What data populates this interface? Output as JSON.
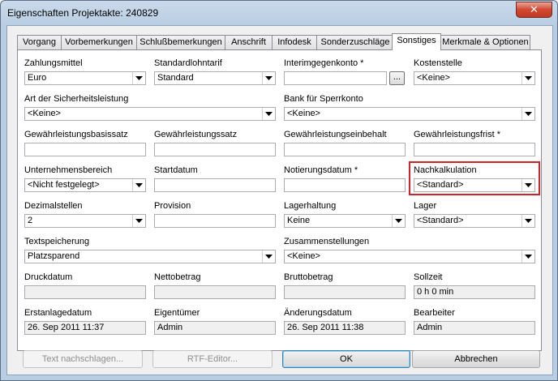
{
  "window": {
    "title": "Eigenschaften Projektakte: 240829",
    "close_glyph": "✕"
  },
  "tabs": [
    {
      "label": "Vorgang",
      "active": false
    },
    {
      "label": "Vorbemerkungen",
      "active": false
    },
    {
      "label": "Schlußbemerkungen",
      "active": false
    },
    {
      "label": "Anschrift",
      "active": false
    },
    {
      "label": "Infodesk",
      "active": false
    },
    {
      "label": "Sonderzuschläge",
      "active": false
    },
    {
      "label": "Sonstiges",
      "active": true
    },
    {
      "label": "Merkmale & Optionen",
      "active": false
    }
  ],
  "form": {
    "zahlungsmittel": {
      "label": "Zahlungsmittel",
      "value": "Euro"
    },
    "standardlohntarif": {
      "label": "Standardlohntarif",
      "value": "Standard"
    },
    "interimgegenkonto": {
      "label": "Interimgegenkonto *",
      "value": "",
      "button": "..."
    },
    "kostenstelle": {
      "label": "Kostenstelle",
      "value": "<Keine>"
    },
    "art_sicherheitsleistung": {
      "label": "Art der Sicherheitsleistung",
      "value": "<Keine>"
    },
    "bank_sperrkonto": {
      "label": "Bank für Sperrkonto",
      "value": "<Keine>"
    },
    "gewaehrleistungsbasissatz": {
      "label": "Gewährleistungsbasissatz",
      "value": ""
    },
    "gewaehrleistungssatz": {
      "label": "Gewährleistungssatz",
      "value": ""
    },
    "gewaehrleistungseinbehalt": {
      "label": "Gewährleistungseinbehalt",
      "value": ""
    },
    "gewaehrleistungsfrist": {
      "label": "Gewährleistungsfrist *",
      "value": ""
    },
    "unternehmensbereich": {
      "label": "Unternehmensbereich",
      "value": "<Nicht festgelegt>"
    },
    "startdatum": {
      "label": "Startdatum",
      "value": ""
    },
    "notierungsdatum": {
      "label": "Notierungsdatum *",
      "value": ""
    },
    "nachkalkulation": {
      "label": "Nachkalkulation",
      "value": "<Standard>"
    },
    "dezimalstellen": {
      "label": "Dezimalstellen",
      "value": "2"
    },
    "provision": {
      "label": "Provision",
      "value": ""
    },
    "lagerhaltung": {
      "label": "Lagerhaltung",
      "value": "Keine"
    },
    "lager": {
      "label": "Lager",
      "value": "<Standard>"
    },
    "textspeicherung": {
      "label": "Textspeicherung",
      "value": "Platzsparend"
    },
    "zusammenstellungen": {
      "label": "Zusammenstellungen",
      "value": "<Keine>"
    },
    "druckdatum": {
      "label": "Druckdatum",
      "value": ""
    },
    "nettobetrag": {
      "label": "Nettobetrag",
      "value": ""
    },
    "bruttobetrag": {
      "label": "Bruttobetrag",
      "value": ""
    },
    "sollzeit": {
      "label": "Sollzeit",
      "value": "0 h 0 min"
    },
    "erstanlagedatum": {
      "label": "Erstanlagedatum",
      "value": "26. Sep 2011 11:37"
    },
    "eigentuemer": {
      "label": "Eigentümer",
      "value": "Admin"
    },
    "aenderungsdatum": {
      "label": "Änderungsdatum",
      "value": "26. Sep 2011 11:38"
    },
    "bearbeiter": {
      "label": "Bearbeiter",
      "value": "Admin"
    }
  },
  "buttons": {
    "text_nachschlagen": "Text nachschlagen...",
    "rtf_editor": "RTF-Editor...",
    "ok": "OK",
    "abbrechen": "Abbrechen"
  },
  "colors": {
    "highlight": "#d3222a",
    "close_button": "#c13a23"
  }
}
